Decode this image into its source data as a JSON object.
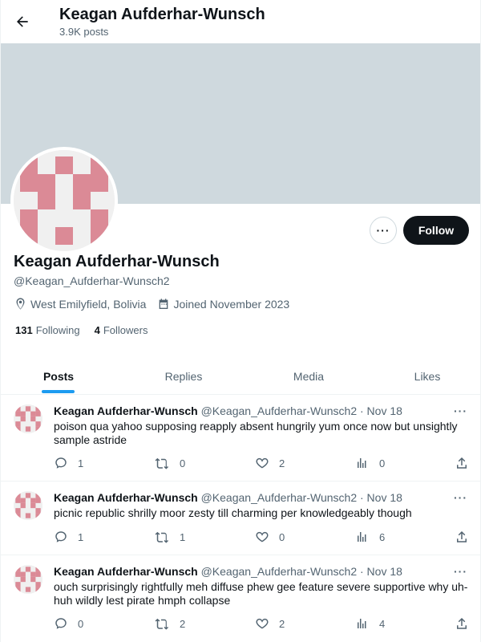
{
  "header": {
    "name": "Keagan Aufderhar-Wunsch",
    "posts_count": "3.9K posts"
  },
  "profile": {
    "name": "Keagan Aufderhar-Wunsch",
    "handle": "@Keagan_Aufderhar-Wunsch2",
    "location": "West Emilyfield, Bolivia",
    "joined": "Joined November 2023",
    "following_count": "131",
    "following_label": "Following",
    "followers_count": "4",
    "followers_label": "Followers",
    "follow_label": "Follow",
    "more_label": "···"
  },
  "tabs": [
    {
      "label": "Posts"
    },
    {
      "label": "Replies"
    },
    {
      "label": "Media"
    },
    {
      "label": "Likes"
    }
  ],
  "posts": [
    {
      "name": "Keagan Aufderhar-Wunsch",
      "handle": "@Keagan_Aufderhar-Wunsch2 · Nov 18",
      "text": "poison qua yahoo supposing reapply absent hungrily yum once now but unsightly sample astride",
      "replies": "1",
      "reposts": "0",
      "likes": "2",
      "views": "0"
    },
    {
      "name": "Keagan Aufderhar-Wunsch",
      "handle": "@Keagan_Aufderhar-Wunsch2 · Nov 18",
      "text": "picnic republic shrilly moor zesty till charming per knowledgeably though",
      "replies": "1",
      "reposts": "1",
      "likes": "0",
      "views": "6"
    },
    {
      "name": "Keagan Aufderhar-Wunsch",
      "handle": "@Keagan_Aufderhar-Wunsch2 · Nov 18",
      "text": "ouch surprisingly rightfully meh diffuse phew gee feature severe supportive why uh-huh wildly lest pirate hmph collapse",
      "replies": "0",
      "reposts": "2",
      "likes": "2",
      "views": "4"
    }
  ],
  "colors": {
    "accent": "#1d9bf0",
    "banner": "#cfd9de",
    "avatar_block": "#db8a96",
    "follow_bg": "#0f1419"
  },
  "icons": [
    "back-arrow-icon",
    "location-icon",
    "calendar-icon",
    "reply-icon",
    "repost-icon",
    "like-icon",
    "views-icon",
    "share-icon",
    "more-icon"
  ]
}
